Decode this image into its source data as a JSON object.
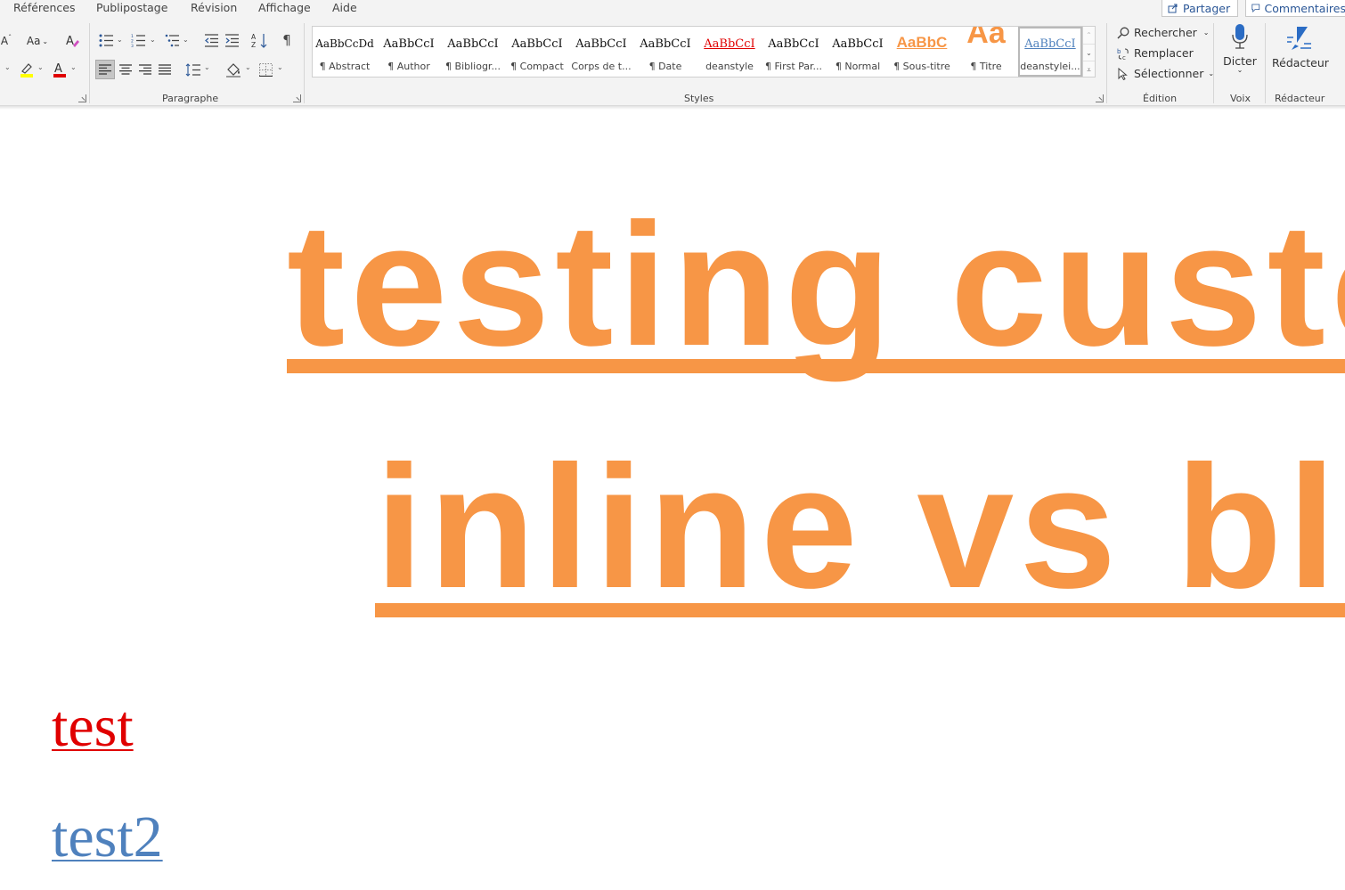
{
  "menu": {
    "tabs": [
      "Références",
      "Publipostage",
      "Révision",
      "Affichage",
      "Aide"
    ],
    "share_label": "Partager",
    "comments_label": "Commentaires"
  },
  "ribbon": {
    "font_group": {
      "grow_label": "A",
      "case_label": "Aa"
    },
    "paragraph_group": {
      "label": "Paragraphe"
    },
    "styles_group": {
      "label": "Styles",
      "styles": [
        {
          "preview": "AaBbCcDd",
          "name": "¶ Abstract"
        },
        {
          "preview": "AaBbCcI",
          "name": "¶ Author"
        },
        {
          "preview": "AaBbCcI",
          "name": "¶ Bibliogr..."
        },
        {
          "preview": "AaBbCcI",
          "name": "¶ Compact"
        },
        {
          "preview": "AaBbCcI",
          "name": "Corps de t..."
        },
        {
          "preview": "AaBbCcI",
          "name": "¶ Date"
        },
        {
          "preview": "AaBbCcI",
          "name": "deanstyle"
        },
        {
          "preview": "AaBbCcI",
          "name": "¶ First Par..."
        },
        {
          "preview": "AaBbCcI",
          "name": "¶ Normal"
        },
        {
          "preview": "AaBbC",
          "name": "¶ Sous-titre"
        },
        {
          "preview": "Aa",
          "name": "¶ Titre"
        },
        {
          "preview": "AaBbCcI",
          "name": "deanstylei..."
        }
      ]
    },
    "edition_group": {
      "label": "Édition",
      "find": "Rechercher",
      "replace": "Remplacer",
      "select": "Sélectionner"
    },
    "voice_group": {
      "label": "Voix",
      "dictate": "Dicter"
    },
    "editor_group": {
      "label": "Rédacteur",
      "editor": "Rédacteur"
    }
  },
  "colors": {
    "accent_orange": "#f79646",
    "link_red": "#e00000",
    "link_blue": "#4f81bd",
    "highlight_yellow": "#ffff00",
    "font_red": "#e00000"
  },
  "document": {
    "title_line_1": "testing custo",
    "title_line_2": "inline vs blo",
    "link_1": "test",
    "link_2": "test2"
  }
}
